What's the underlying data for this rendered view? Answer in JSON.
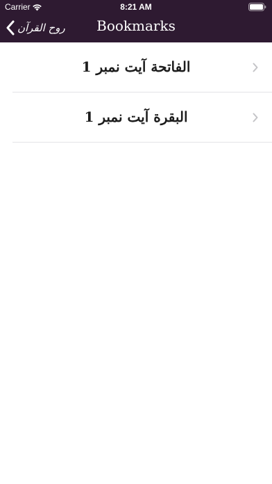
{
  "status_bar": {
    "carrier": "Carrier",
    "time": "8:21 AM"
  },
  "nav": {
    "back_label": "روح القرآن",
    "title": "Bookmarks"
  },
  "bookmarks": [
    {
      "label": "الفاتحة آیت نمبر 1"
    },
    {
      "label": "البقرة آیت نمبر 1"
    }
  ],
  "colors": {
    "header_background": "#2e1a31",
    "separator": "#e3e3e6",
    "chevron": "#c4c4c7"
  },
  "icons": {
    "back": "chevron-left-icon",
    "row_disclosure": "chevron-right-icon",
    "wifi": "wifi-icon",
    "battery": "battery-icon"
  }
}
